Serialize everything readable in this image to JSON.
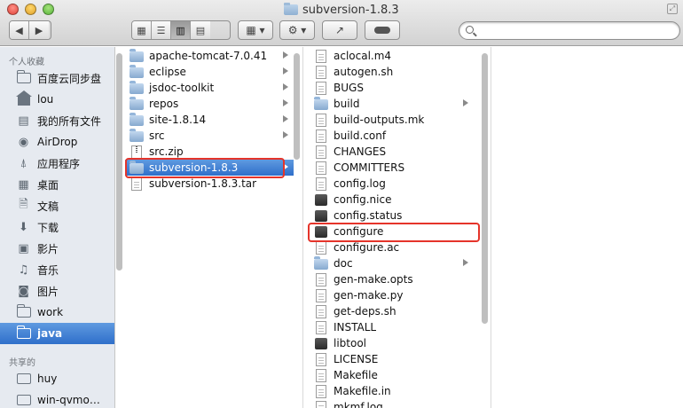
{
  "window": {
    "title": "subversion-1.8.3"
  },
  "toolbar": {
    "search_placeholder": "",
    "search_value": ""
  },
  "sidebar": {
    "favorites_heading": "个人收藏",
    "shared_heading": "共享的",
    "favorites": [
      {
        "label": "百度云同步盘",
        "icon": "folder-icon"
      },
      {
        "label": "lou",
        "icon": "home-icon"
      },
      {
        "label": "我的所有文件",
        "icon": "all-files-icon"
      },
      {
        "label": "AirDrop",
        "icon": "airdrop-icon"
      },
      {
        "label": "应用程序",
        "icon": "applications-icon"
      },
      {
        "label": "桌面",
        "icon": "desktop-icon"
      },
      {
        "label": "文稿",
        "icon": "documents-icon"
      },
      {
        "label": "下载",
        "icon": "downloads-icon"
      },
      {
        "label": "影片",
        "icon": "movies-icon"
      },
      {
        "label": "音乐",
        "icon": "music-icon"
      },
      {
        "label": "图片",
        "icon": "pictures-icon"
      },
      {
        "label": "work",
        "icon": "folder-icon"
      },
      {
        "label": "java",
        "icon": "folder-icon",
        "selected": true
      }
    ],
    "shared": [
      {
        "label": "huy",
        "icon": "computer-icon"
      },
      {
        "label": "win-qvmo…",
        "icon": "computer-icon"
      }
    ]
  },
  "column1": [
    {
      "name": "apache-tomcat-7.0.41",
      "kind": "folder",
      "has_children": true
    },
    {
      "name": "eclipse",
      "kind": "folder",
      "has_children": true
    },
    {
      "name": "jsdoc-toolkit",
      "kind": "folder",
      "has_children": true
    },
    {
      "name": "repos",
      "kind": "folder",
      "has_children": true
    },
    {
      "name": "site-1.8.14",
      "kind": "folder",
      "has_children": true
    },
    {
      "name": "src",
      "kind": "folder",
      "has_children": true
    },
    {
      "name": "src.zip",
      "kind": "zip",
      "has_children": false
    },
    {
      "name": "subversion-1.8.3",
      "kind": "folder",
      "has_children": true,
      "selected": true
    },
    {
      "name": "subversion-1.8.3.tar",
      "kind": "document",
      "has_children": false
    }
  ],
  "column2": [
    {
      "name": "aclocal.m4",
      "kind": "document"
    },
    {
      "name": "autogen.sh",
      "kind": "document"
    },
    {
      "name": "BUGS",
      "kind": "document"
    },
    {
      "name": "build",
      "kind": "folder",
      "has_children": true
    },
    {
      "name": "build-outputs.mk",
      "kind": "document"
    },
    {
      "name": "build.conf",
      "kind": "document"
    },
    {
      "name": "CHANGES",
      "kind": "document"
    },
    {
      "name": "COMMITTERS",
      "kind": "document"
    },
    {
      "name": "config.log",
      "kind": "document"
    },
    {
      "name": "config.nice",
      "kind": "executable"
    },
    {
      "name": "config.status",
      "kind": "executable"
    },
    {
      "name": "configure",
      "kind": "executable",
      "highlighted": true
    },
    {
      "name": "configure.ac",
      "kind": "document"
    },
    {
      "name": "doc",
      "kind": "folder",
      "has_children": true
    },
    {
      "name": "gen-make.opts",
      "kind": "document"
    },
    {
      "name": "gen-make.py",
      "kind": "document"
    },
    {
      "name": "get-deps.sh",
      "kind": "document"
    },
    {
      "name": "INSTALL",
      "kind": "document"
    },
    {
      "name": "libtool",
      "kind": "executable"
    },
    {
      "name": "LICENSE",
      "kind": "document"
    },
    {
      "name": "Makefile",
      "kind": "document"
    },
    {
      "name": "Makefile.in",
      "kind": "document"
    },
    {
      "name": "mkmf.log",
      "kind": "document"
    }
  ],
  "colors": {
    "selection": "#3a78d0",
    "annotation": "#e5342a",
    "sidebar_bg": "#e6eaf0"
  }
}
